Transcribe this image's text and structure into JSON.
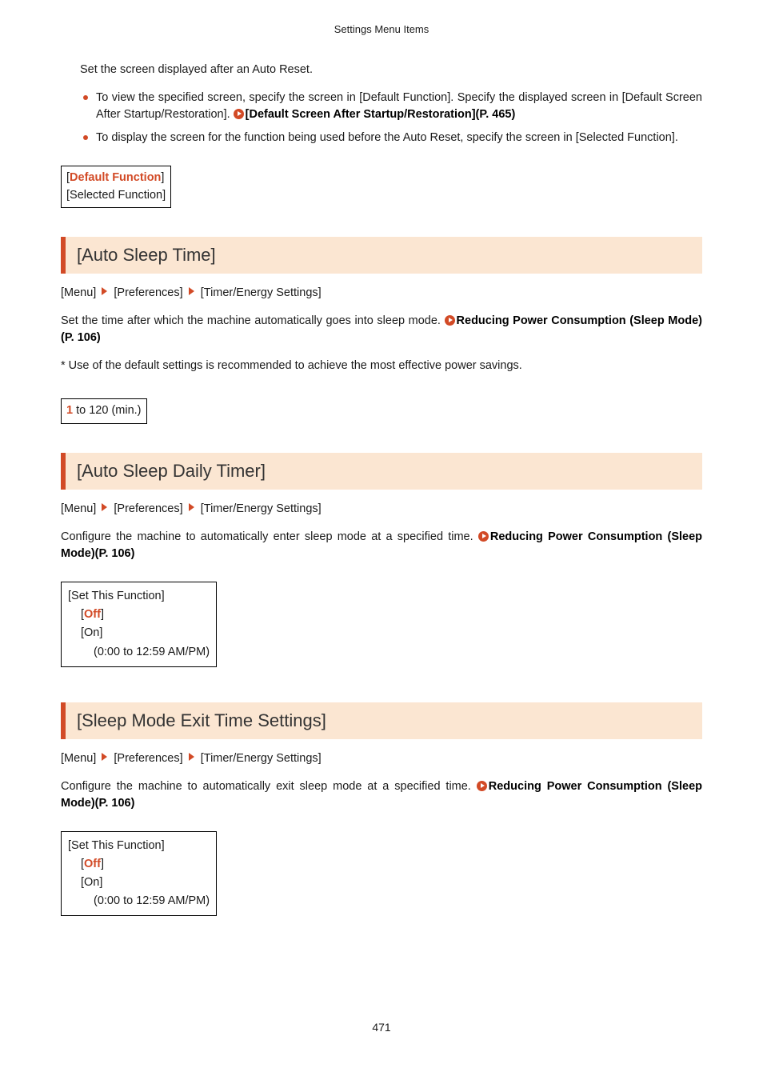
{
  "running_header": "Settings Menu Items",
  "page_number": "471",
  "top_section": {
    "intro": "Set the screen displayed after an Auto Reset.",
    "bullet1_pre": "To view the specified screen, specify the screen in [Default Function]. Specify the displayed screen in [Default Screen After Startup/Restoration]. ",
    "bullet1_link": "[Default Screen After Startup/Restoration](P. 465)",
    "bullet2": "To display the screen for the function being used before the Auto Reset, specify the screen in [Selected Function].",
    "box_default": "Default Function",
    "box_other": "[Selected Function]"
  },
  "sections": [
    {
      "title": "[Auto Sleep Time]",
      "crumb1": "[Menu]",
      "crumb2": "[Preferences]",
      "crumb3": "[Timer/Energy Settings]",
      "para_pre": "Set the time after which the machine automatically goes into sleep mode. ",
      "para_link": "Reducing Power Consumption (Sleep Mode)(P. 106)",
      "note": "* Use of the default settings is recommended to achieve the most effective power savings.",
      "range_default": "1",
      "range_rest": " to 120 (min.)"
    },
    {
      "title": "[Auto Sleep Daily Timer]",
      "crumb1": "[Menu]",
      "crumb2": "[Preferences]",
      "crumb3": "[Timer/Energy Settings]",
      "para_pre": "Configure the machine to automatically enter sleep mode at a specified time. ",
      "para_link": "Reducing Power Consumption (Sleep Mode)(P. 106)",
      "box_header": "[Set This Function]",
      "box_off": "Off",
      "box_on": "[On]",
      "box_range": "(0:00 to 12:59 AM/PM)"
    },
    {
      "title": "[Sleep Mode Exit Time Settings]",
      "crumb1": "[Menu]",
      "crumb2": "[Preferences]",
      "crumb3": "[Timer/Energy Settings]",
      "para_pre": "Configure the machine to automatically exit sleep mode at a specified time. ",
      "para_link": "Reducing Power Consumption (Sleep Mode)(P. 106)",
      "box_header": "[Set This Function]",
      "box_off": "Off",
      "box_on": "[On]",
      "box_range": "(0:00 to 12:59 AM/PM)"
    }
  ]
}
